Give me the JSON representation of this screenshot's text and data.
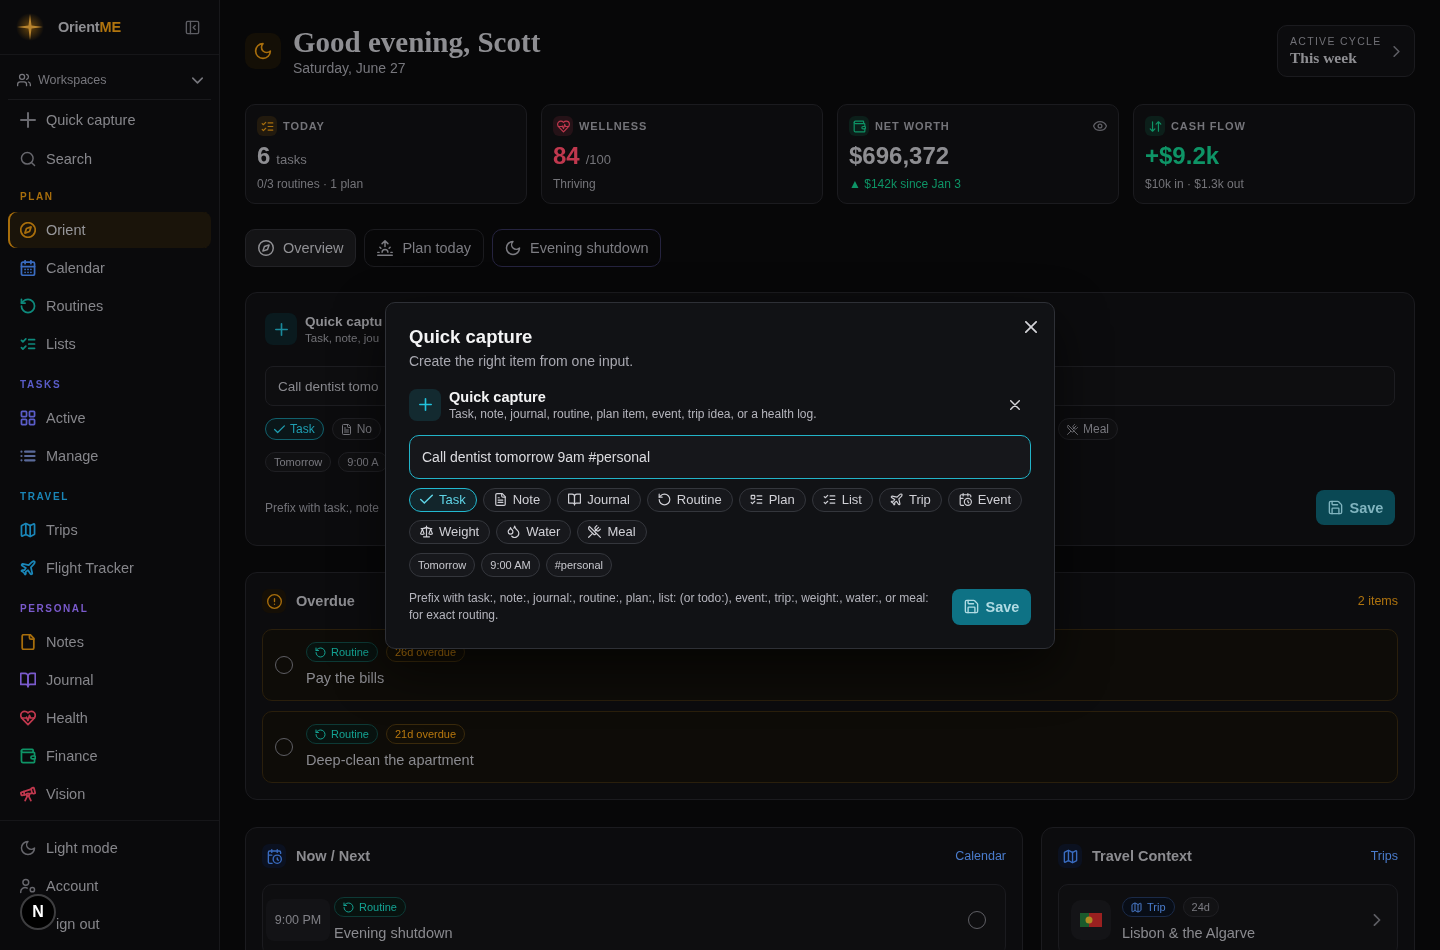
{
  "sidebar": {
    "brand": {
      "name": "Orient",
      "accent": "ME"
    },
    "workspaces": {
      "label": "Workspaces",
      "expanded": false
    },
    "actions": [
      {
        "label": "Quick capture"
      },
      {
        "label": "Search"
      }
    ],
    "sections": [
      {
        "title": "PLAN",
        "color": "#a86e0c",
        "items": [
          {
            "label": "Orient",
            "selected": true,
            "color": "#a86e0c"
          },
          {
            "label": "Calendar",
            "selected": false,
            "color": "#3a6cc0"
          },
          {
            "label": "Routines",
            "selected": false,
            "color": "#0e8a7d"
          },
          {
            "label": "Lists",
            "selected": false,
            "color": "#0e8a7d"
          }
        ]
      },
      {
        "title": "TASKS",
        "color": "#5a5cc8",
        "items": [
          {
            "label": "Active",
            "selected": false,
            "color": "#5a5cc8"
          },
          {
            "label": "Manage",
            "selected": false,
            "color": "#5a6a9a"
          }
        ]
      },
      {
        "title": "TRAVEL",
        "color": "#1a86b8",
        "items": [
          {
            "label": "Trips",
            "selected": false,
            "color": "#1a86b8"
          },
          {
            "label": "Flight Tracker",
            "selected": false,
            "color": "#1a86b8"
          }
        ]
      },
      {
        "title": "PERSONAL",
        "color": "#7a5acc",
        "items": [
          {
            "label": "Notes",
            "selected": false,
            "color": "#a86e0c"
          },
          {
            "label": "Journal",
            "selected": false,
            "color": "#7a5acc"
          },
          {
            "label": "Health",
            "selected": false,
            "color": "#c0384e"
          },
          {
            "label": "Finance",
            "selected": false,
            "color": "#0e9466"
          },
          {
            "label": "Vision",
            "selected": false,
            "color": "#c0384e"
          }
        ]
      }
    ],
    "footer": [
      {
        "label": "Light mode"
      },
      {
        "label": "Account"
      },
      {
        "label": "ign out"
      }
    ]
  },
  "dev_badge": {
    "label": "N"
  },
  "header": {
    "title": "Good evening, Scott",
    "date": "Saturday, June 27",
    "cycle": {
      "label": "ACTIVE CYCLE",
      "value": "This week"
    }
  },
  "stats": [
    {
      "label": "TODAY",
      "color": "#a86e0c",
      "value": "6",
      "unit": "tasks",
      "detail": "0/3 routines · 1 plan",
      "value_tinted": false,
      "detail_tinted": false,
      "privacy_toggle": false
    },
    {
      "label": "WELLNESS",
      "color": "#c0384e",
      "value": "84",
      "unit": "/100",
      "detail": "Thriving",
      "value_tinted": true,
      "detail_tinted": false,
      "privacy_toggle": false
    },
    {
      "label": "NET WORTH",
      "color": "#0e9466",
      "value": "$696,372",
      "detail": "▲ $142k since Jan 3",
      "value_tinted": false,
      "detail_tinted": true,
      "privacy_toggle": true
    },
    {
      "label": "CASH FLOW",
      "color": "#0e9466",
      "value": "+$9.2k",
      "detail": "$10k in · $1.3k out",
      "value_tinted": true,
      "detail_tinted": false,
      "privacy_toggle": false
    }
  ],
  "tabs": [
    {
      "label": "Overview",
      "selected": true,
      "suggested": false
    },
    {
      "label": "Plan today",
      "selected": false,
      "suggested": false
    },
    {
      "label": "Evening shutdown",
      "selected": false,
      "suggested": true
    }
  ],
  "capture_card": {
    "title": "Quick captu",
    "description": "Task, note, jou",
    "input": {
      "value": "Call dentist tomo"
    },
    "types": [
      {
        "label": "Task",
        "selected": true
      },
      {
        "label": "No",
        "selected": false
      }
    ],
    "types_right": [
      {
        "label": "Meal",
        "selected": false
      }
    ],
    "chips": [
      "Tomorrow",
      "9:00 A"
    ],
    "hint": "Prefix with task:, note",
    "save": "Save"
  },
  "overdue": {
    "title": "Overdue",
    "count": "2 items",
    "items": [
      {
        "tags": [
          {
            "label": "Routine",
            "kind": "routine"
          },
          {
            "label": "26d overdue",
            "kind": "overdue"
          }
        ],
        "title": "Pay the bills",
        "done": false
      },
      {
        "tags": [
          {
            "label": "Routine",
            "kind": "routine"
          },
          {
            "label": "21d overdue",
            "kind": "overdue"
          }
        ],
        "title": "Deep-clean the apartment",
        "done": false
      }
    ]
  },
  "now_next": {
    "title": "Now / Next",
    "link": "Calendar",
    "items": [
      {
        "time": "9:00 PM",
        "tags": [
          {
            "label": "Routine",
            "kind": "routine"
          }
        ],
        "title": "Evening shutdown",
        "done": false
      }
    ]
  },
  "travel": {
    "title": "Travel Context",
    "link": "Trips",
    "items": [
      {
        "tags": [
          {
            "label": "Trip",
            "kind": "trip"
          },
          {
            "label": "24d",
            "kind": "plain"
          }
        ],
        "title": "Lisbon & the Algarve"
      }
    ]
  },
  "modal": {
    "title": "Quick capture",
    "subtitle": "Create the right item from one input.",
    "capture": {
      "title": "Quick capture",
      "description": "Task, note, journal, routine, plan item, event, trip idea, or a health log.",
      "input": {
        "value": "Call dentist tomorrow 9am #personal",
        "focused": true
      },
      "types": [
        {
          "label": "Task",
          "selected": true
        },
        {
          "label": "Note",
          "selected": false
        },
        {
          "label": "Journal",
          "selected": false
        },
        {
          "label": "Routine",
          "selected": false
        },
        {
          "label": "Plan",
          "selected": false
        },
        {
          "label": "List",
          "selected": false
        },
        {
          "label": "Trip",
          "selected": false
        },
        {
          "label": "Event",
          "selected": false
        },
        {
          "label": "Weight",
          "selected": false
        },
        {
          "label": "Water",
          "selected": false
        },
        {
          "label": "Meal",
          "selected": false
        }
      ],
      "chips": [
        "Tomorrow",
        "9:00 AM",
        "#personal"
      ],
      "hint": "Prefix with task:, note:, journal:, routine:, plan:, list: (or todo:), event:, trip:, weight:, water:, or meal: for exact routing.",
      "save": "Save"
    }
  }
}
